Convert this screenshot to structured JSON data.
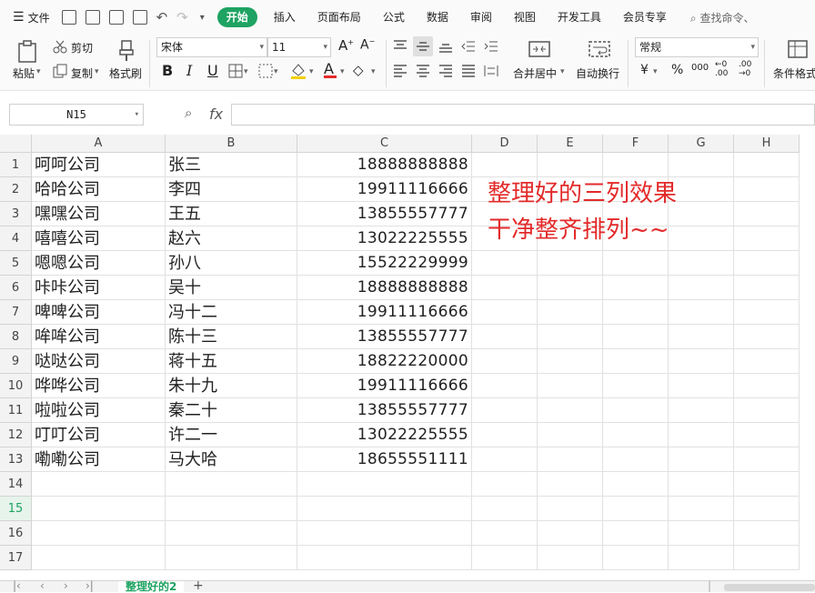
{
  "menubar": {
    "file_label": "文件",
    "tabs": [
      {
        "label": "开始",
        "active": true
      },
      {
        "label": "插入",
        "active": false
      },
      {
        "label": "页面布局",
        "active": false
      },
      {
        "label": "公式",
        "active": false
      },
      {
        "label": "数据",
        "active": false
      },
      {
        "label": "审阅",
        "active": false
      },
      {
        "label": "视图",
        "active": false
      },
      {
        "label": "开发工具",
        "active": false
      },
      {
        "label": "会员专享",
        "active": false
      }
    ],
    "search_placeholder": "查找命令、"
  },
  "ribbon": {
    "paste": "粘贴",
    "cut": "剪切",
    "copy": "复制",
    "format_painter": "格式刷",
    "font_name": "宋体",
    "font_size": "11",
    "merge_center": "合并居中",
    "wrap_text": "自动换行",
    "number_format": "常规",
    "conditional_format": "条件格式"
  },
  "formula_bar": {
    "name_box": "N15",
    "fx_label": "fx",
    "formula": ""
  },
  "columns": [
    "A",
    "B",
    "C",
    "D",
    "E",
    "F",
    "G",
    "H"
  ],
  "rows": [
    {
      "n": "1",
      "a": "呵呵公司",
      "b": "张三",
      "c": "18888888888"
    },
    {
      "n": "2",
      "a": "哈哈公司",
      "b": "李四",
      "c": "19911116666"
    },
    {
      "n": "3",
      "a": "嘿嘿公司",
      "b": "王五",
      "c": "13855557777"
    },
    {
      "n": "4",
      "a": "嘻嘻公司",
      "b": "赵六",
      "c": "13022225555"
    },
    {
      "n": "5",
      "a": "嗯嗯公司",
      "b": "孙八",
      "c": "15522229999"
    },
    {
      "n": "6",
      "a": "咔咔公司",
      "b": "吴十",
      "c": "18888888888"
    },
    {
      "n": "7",
      "a": "啤啤公司",
      "b": "冯十二",
      "c": "19911116666"
    },
    {
      "n": "8",
      "a": "哞哞公司",
      "b": "陈十三",
      "c": "13855557777"
    },
    {
      "n": "9",
      "a": "哒哒公司",
      "b": "蒋十五",
      "c": "18822220000"
    },
    {
      "n": "10",
      "a": "哗哗公司",
      "b": "朱十九",
      "c": "19911116666"
    },
    {
      "n": "11",
      "a": "啦啦公司",
      "b": "秦二十",
      "c": "13855557777"
    },
    {
      "n": "12",
      "a": "叮叮公司",
      "b": "许二一",
      "c": "13022225555"
    },
    {
      "n": "13",
      "a": "嘞嘞公司",
      "b": "马大哈",
      "c": "18655551111"
    },
    {
      "n": "14",
      "a": "",
      "b": "",
      "c": ""
    },
    {
      "n": "15",
      "a": "",
      "b": "",
      "c": ""
    },
    {
      "n": "16",
      "a": "",
      "b": "",
      "c": ""
    },
    {
      "n": "17",
      "a": "",
      "b": "",
      "c": ""
    }
  ],
  "selected_row": "15",
  "note": {
    "line1": "整理好的三列效果",
    "line2": "干净整齐排列~~",
    "color": "#e32a2a"
  },
  "sheet_tab": {
    "label": "整理好的2",
    "add": "+"
  },
  "accent_color": "#1ea362"
}
